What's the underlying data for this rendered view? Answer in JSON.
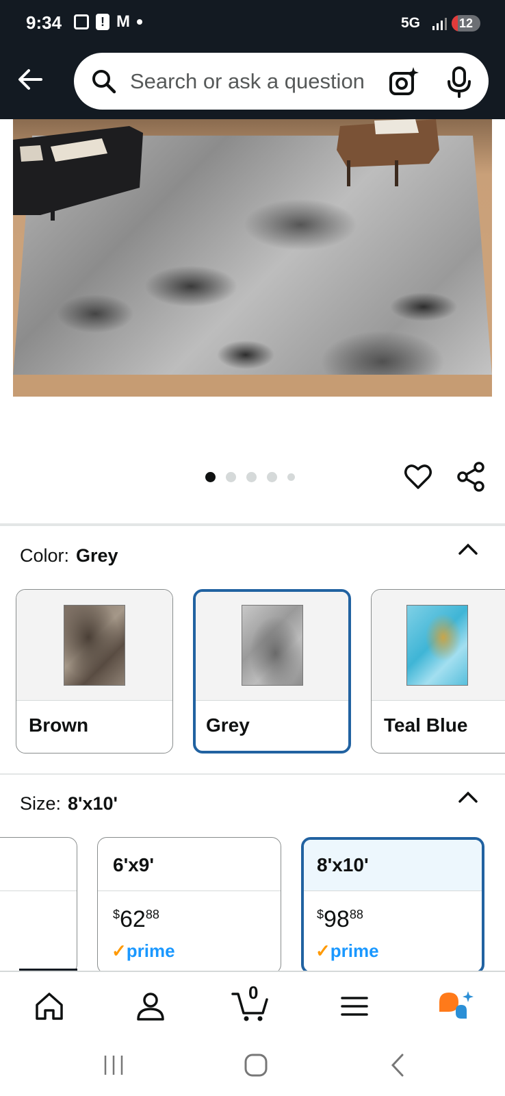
{
  "status_bar": {
    "time": "9:34",
    "network": "5G",
    "battery": "12"
  },
  "header": {
    "search_placeholder": "Search or ask a question"
  },
  "carousel": {
    "dot_count": 5,
    "active_index": 0
  },
  "color": {
    "label": "Color:",
    "selected": "Grey",
    "options": [
      {
        "label": "Brown"
      },
      {
        "label": "Grey"
      },
      {
        "label": "Teal Blue"
      }
    ]
  },
  "size": {
    "label": "Size:",
    "selected": "8'x10'",
    "options": [
      {
        "label": "6'x9'",
        "price_dollars": "62",
        "price_cents": "88",
        "currency": "$",
        "badge": "prime"
      },
      {
        "label": "8'x10'",
        "price_dollars": "98",
        "price_cents": "88",
        "currency": "$",
        "badge": "prime"
      }
    ]
  },
  "nav": {
    "cart_count": "0",
    "items": [
      "home-icon",
      "account-icon",
      "cart-icon",
      "menu-icon",
      "rufus-icon"
    ]
  },
  "colors": {
    "header_bg": "#131a22",
    "selected_border": "#2162a1",
    "prime_blue": "#1a98ff",
    "prime_check": "#ff9900"
  }
}
